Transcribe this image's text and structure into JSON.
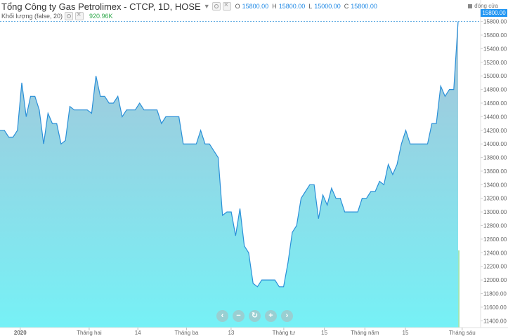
{
  "header": {
    "title": "Tổng Công ty Gas Petrolimex - CTCP, 1D, HOSE",
    "ohlc": [
      {
        "key": "O",
        "value": "15800.00"
      },
      {
        "key": "H",
        "value": "15800.00"
      },
      {
        "key": "L",
        "value": "15000.00"
      },
      {
        "key": "C",
        "value": "15800.00"
      }
    ]
  },
  "volume_study": {
    "label": "Khối lượng (false, 20)",
    "value": "920.96K"
  },
  "legend": {
    "label": "đóng cửa"
  },
  "last_price_label": "15800.00",
  "navigation": {
    "buttons": [
      "‹",
      "−",
      "↻",
      "+",
      "›"
    ]
  },
  "colors": {
    "line": "#2a8fd8",
    "area_top": "#a8c3d8",
    "area_bottom": "#76f1f6",
    "volume_bar": "#74d6a6",
    "volume_bar_alt": "#b7bcc0",
    "last_volume_bar": "#8fe0a8",
    "price_tag": "#2196f3"
  },
  "chart_data": {
    "type": "area",
    "series": [
      {
        "values": [
          14200,
          14200,
          14100,
          14100,
          14200,
          14900,
          14400,
          14700,
          14700,
          14500,
          14000,
          14450,
          14300,
          14300,
          14000,
          14050,
          14550,
          14500,
          14500,
          14500,
          14500,
          14450,
          15000,
          14700,
          14700,
          14600,
          14600,
          14700,
          14400,
          14500,
          14500,
          14500,
          14600,
          14500,
          14500,
          14500,
          14500,
          14300,
          14400,
          14400,
          14400,
          14400,
          14000,
          14000,
          14000,
          14000,
          14200,
          14000,
          14000,
          13900,
          13800,
          12950,
          13000,
          13000,
          12650,
          13050,
          12500,
          12400,
          11950,
          11900,
          12000,
          12000,
          12000,
          12000,
          11900,
          11900,
          12250,
          12700,
          12800,
          13200,
          13300,
          13400,
          13400,
          12900,
          13250,
          13100,
          13350,
          13200,
          13200,
          13000,
          13000,
          13000,
          13000,
          13200,
          13200,
          13300,
          13300,
          13450,
          13400,
          13700,
          13550,
          13700,
          14000,
          14200,
          14000,
          14000,
          14000,
          14000,
          14000,
          14300,
          14300,
          14850,
          14700,
          14800,
          14800,
          15800
        ]
      }
    ],
    "volume_values": [
      0.05,
      0.08,
      0.03,
      0.02,
      0.06,
      0.12,
      0.07,
      0.1,
      0.06,
      0.04,
      0.02,
      0.05,
      0.03,
      0.02,
      0.03,
      0.04,
      0.02,
      0.03,
      0.02,
      0.03,
      0.05,
      0.04,
      0.25,
      0.12,
      0.1,
      0.18,
      0.3,
      0.22,
      0.08,
      0.05,
      0.12,
      0.05,
      0.02,
      0.02,
      0.05,
      0.07,
      0.04,
      0.03,
      0.02,
      0.02,
      0.02,
      0.02,
      0.02,
      0.05,
      0.05,
      0.03,
      0.02,
      0.06,
      0.04,
      0.05,
      0.08,
      0.12,
      0.1,
      0.08,
      0.06,
      0.07,
      0.1,
      0.06,
      0.05,
      0.03,
      0.02,
      0.03,
      0.05,
      0.06,
      0.06,
      0.03,
      0.02,
      0.02,
      0.02,
      0.02,
      0.02,
      0.06,
      0.06,
      0.1,
      0.14,
      0.1,
      0.12,
      0.55,
      0.15,
      0.2,
      0.18,
      0.2,
      0.22,
      0.15,
      0.08,
      0.05,
      0.04,
      0.05,
      0.06,
      0.05,
      0.12,
      0.1,
      0.08,
      0.06,
      0.05,
      0.08,
      0.22,
      0.1,
      0.12,
      0.08,
      0.06,
      0.1,
      0.07,
      0.09,
      0.15,
      0.12,
      0.08,
      0.05,
      0.05,
      0.04,
      0.06,
      0.08,
      0.12,
      3.0
    ],
    "volume_value_last": "920.96K",
    "y_ticks": [
      11400,
      11600,
      11800,
      12000,
      12200,
      12400,
      12600,
      12800,
      13000,
      13200,
      13400,
      13600,
      13800,
      14000,
      14200,
      14400,
      14600,
      14800,
      15000,
      15200,
      15400,
      15600,
      15800
    ],
    "y_tick_labels": [
      "11400.00",
      "11600.00",
      "11800.00",
      "12000.00",
      "12200.00",
      "12400.00",
      "12600.00",
      "12800.00",
      "13000.00",
      "13200.00",
      "13400.00",
      "13600.00",
      "13800.00",
      "14000.00",
      "14200.00",
      "14400.00",
      "14600.00",
      "14800.00",
      "15000.00",
      "15200.00",
      "15400.00",
      "15600.00",
      "15800.00"
    ],
    "ylim": [
      11300,
      15930
    ],
    "x_tick_labels": [
      {
        "label": "2020",
        "index": 5
      },
      {
        "label": "Tháng hai",
        "index": 22
      },
      {
        "label": "14",
        "index": 34
      },
      {
        "label": "Tháng ba",
        "index": 46
      },
      {
        "label": "13",
        "index": 57
      },
      {
        "label": "Tháng tư",
        "index": 70
      },
      {
        "label": "15",
        "index": 80
      },
      {
        "label": "Tháng năm",
        "index": 90
      },
      {
        "label": "15",
        "index": 100
      },
      {
        "label": "Tháng sáu",
        "index": 114
      }
    ],
    "grid": false,
    "legend_position": "top-right"
  }
}
